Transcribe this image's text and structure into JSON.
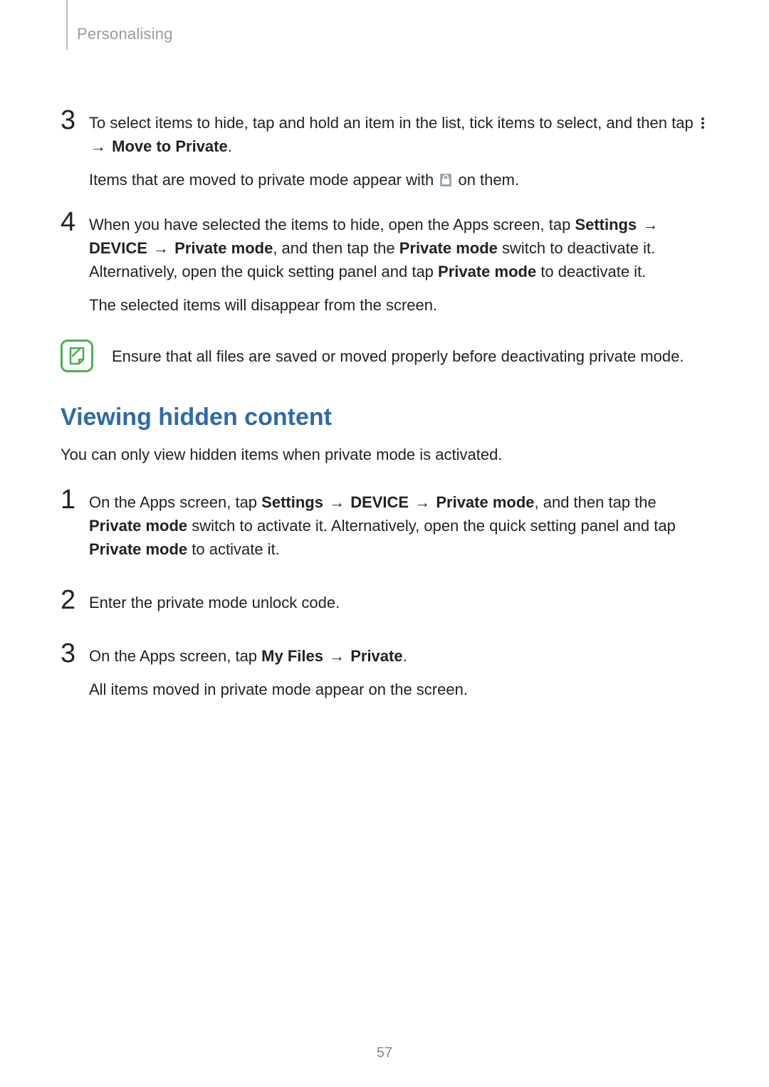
{
  "header": {
    "section": "Personalising"
  },
  "step3": {
    "num": "3",
    "para1_a": "To select items to hide, tap and hold an item in the list, tick items to select, and then tap ",
    "para1_b": " → ",
    "para1_c": "Move to Private",
    "para1_d": ".",
    "para2_a": "Items that are moved to private mode appear with ",
    "para2_b": " on them."
  },
  "step4": {
    "num": "4",
    "p1_a": "When you have selected the items to hide, open the Apps screen, tap ",
    "p1_b": "Settings",
    "p1_c": " → ",
    "p1_d": "DEVICE",
    "p1_e": " → ",
    "p1_f": "Private mode",
    "p1_g": ", and then tap the ",
    "p1_h": "Private mode",
    "p1_i": " switch to deactivate it. Alternatively, open the quick setting panel and tap ",
    "p1_j": "Private mode",
    "p1_k": " to deactivate it.",
    "p2": "The selected items will disappear from the screen."
  },
  "note": {
    "text": "Ensure that all files are saved or moved properly before deactivating private mode."
  },
  "viewing": {
    "heading": "Viewing hidden content",
    "intro": "You can only view hidden items when private mode is activated."
  },
  "vstep1": {
    "num": "1",
    "a": "On the Apps screen, tap ",
    "b": "Settings",
    "c": " → ",
    "d": "DEVICE",
    "e": " → ",
    "f": "Private mode",
    "g": ", and then tap the ",
    "h": "Private mode",
    "i": " switch to activate it. Alternatively, open the quick setting panel and tap ",
    "j": "Private mode",
    "k": " to activate it."
  },
  "vstep2": {
    "num": "2",
    "text": "Enter the private mode unlock code."
  },
  "vstep3": {
    "num": "3",
    "a": "On the Apps screen, tap ",
    "b": "My Files",
    "c": " → ",
    "d": "Private",
    "e": ".",
    "p2": "All items moved in private mode appear on the screen."
  },
  "page_number": "57"
}
